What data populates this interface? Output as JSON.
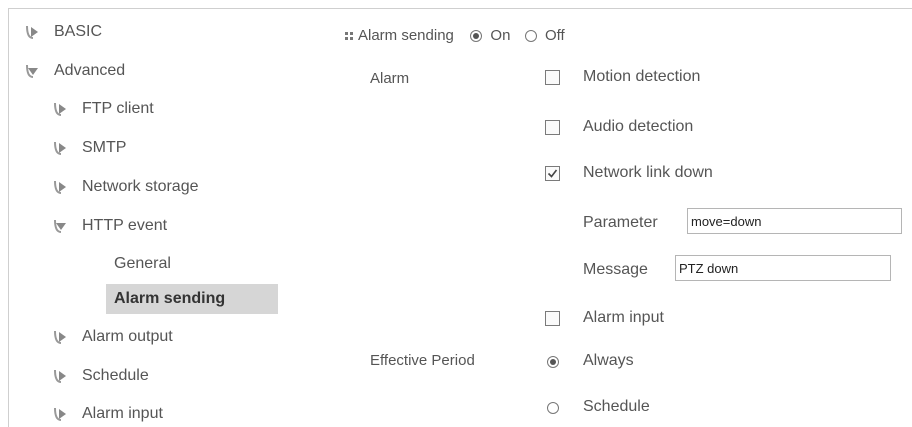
{
  "sidebar": {
    "items": [
      {
        "label": "BASIC",
        "expanded": false
      },
      {
        "label": "Advanced",
        "expanded": true
      },
      {
        "label": "FTP client",
        "expanded": false
      },
      {
        "label": "SMTP",
        "expanded": false
      },
      {
        "label": "Network storage",
        "expanded": false
      },
      {
        "label": "HTTP event",
        "expanded": true
      },
      {
        "label": "Alarm output",
        "expanded": false
      },
      {
        "label": "Schedule",
        "expanded": false
      },
      {
        "label": "Alarm input",
        "expanded": false
      }
    ],
    "sub_items": [
      {
        "label": "General",
        "active": false
      },
      {
        "label": "Alarm sending",
        "active": true
      }
    ]
  },
  "main": {
    "alarm_sending": {
      "label": "Alarm sending",
      "on_label": "On",
      "off_label": "Off",
      "selected": "On"
    },
    "alarm": {
      "label": "Alarm",
      "motion_detection": {
        "label": "Motion detection",
        "checked": false
      },
      "audio_detection": {
        "label": "Audio detection",
        "checked": false
      },
      "network_link_down": {
        "label": "Network link down",
        "checked": true
      },
      "parameter": {
        "label": "Parameter",
        "value": "move=down"
      },
      "message": {
        "label": "Message",
        "value": "PTZ down"
      },
      "alarm_input": {
        "label": "Alarm input",
        "checked": false
      }
    },
    "effective_period": {
      "label": "Effective Period",
      "always_label": "Always",
      "schedule_label": "Schedule",
      "selected": "Always"
    }
  },
  "colors": {
    "text": "#555555",
    "active_bg": "#d6d6d6",
    "border": "#cfcfcf"
  }
}
